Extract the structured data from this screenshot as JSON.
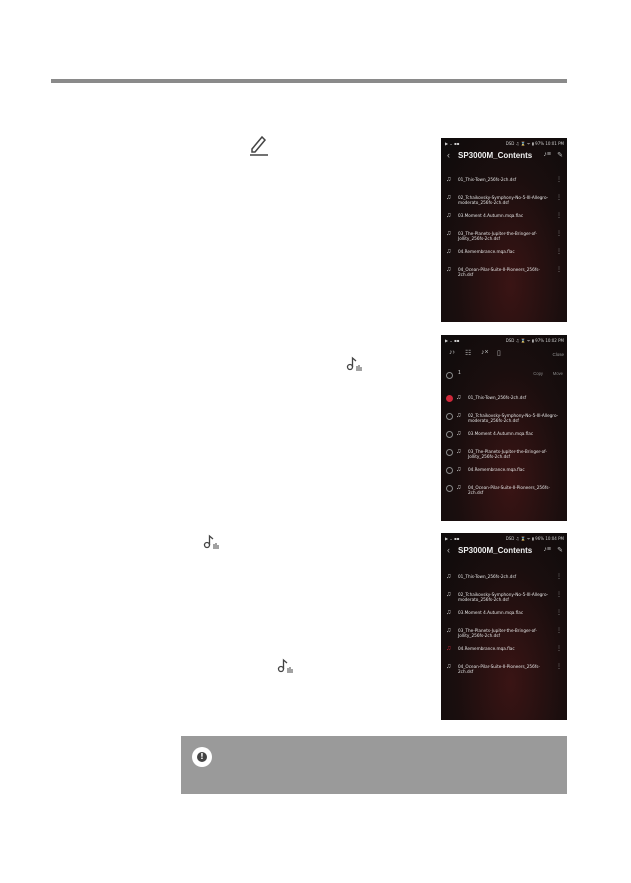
{
  "screens": {
    "contents": {
      "status_left": "▶ ⌄ ▪▪",
      "status_right": "DSD ♫ ⌛ ᯤ ▮ 97%  10:01 PM",
      "title": "SP3000M_Contents",
      "items": [
        "01_This-Town_256fs-2ch.dsf",
        "02_Tchaikovsky-Symphony-No-5-III-Allegro-moderato_256fs-2ch.dsf",
        "03.Moment 4.Autumn.mqa.flac",
        "03_The-Planets-Jupiter-the-Bringer-of-Jollity_256fs-2ch.dsf",
        "04.Remembrance.mqa.flac",
        "04_Ocean-Pilar-Suite-II-Pioneers_256fs-2ch.dsf"
      ]
    },
    "select": {
      "status_left": "▶ ⌄ ▪▪",
      "status_right": "DSD ♫ ⌛ ᯤ ▮ 97%  10:02 PM",
      "close_label": "Close",
      "count": "1",
      "copy_label": "Copy",
      "move_label": "Move",
      "items": [
        "01_This-Town_256fs-2ch.dsf",
        "02_Tchaikovsky-Symphony-No-5-III-Allegro-moderato_256fs-2ch.dsf",
        "03.Moment 4.Autumn.mqa.flac",
        "03_The-Planets-Jupiter-the-Bringer-of-Jollity_256fs-2ch.dsf",
        "04.Remembrance.mqa.flac",
        "04_Ocean-Pilar-Suite-II-Pioneers_256fs-2ch.dsf"
      ]
    },
    "playing": {
      "status_left": "▶ ⌄ ▪▪",
      "status_right": "DSD ♫ ⌛ ᯤ ▮ 96%  10:04 PM",
      "title": "SP3000M_Contents",
      "items": [
        "01_This-Town_256fs-2ch.dsf",
        "02_Tchaikovsky-Symphony-No-5-III-Allegro-moderato_256fs-2ch.dsf",
        "03.Moment 4.Autumn.mqa.flac",
        "03_The-Planets-Jupiter-the-Bringer-of-Jollity_256fs-2ch.dsf",
        "04.Remembrance.mqa.flac",
        "04_Ocean-Pilar-Suite-II-Pioneers_256fs-2ch.dsf"
      ]
    }
  },
  "icons": {
    "edit": "pencil-icon",
    "play_selected": "play-selected-icon",
    "warning": "warning-icon"
  },
  "colors": {
    "accent": "#d0283a",
    "notice_bg": "#9a9a9a",
    "rule": "#8a8a8a"
  }
}
